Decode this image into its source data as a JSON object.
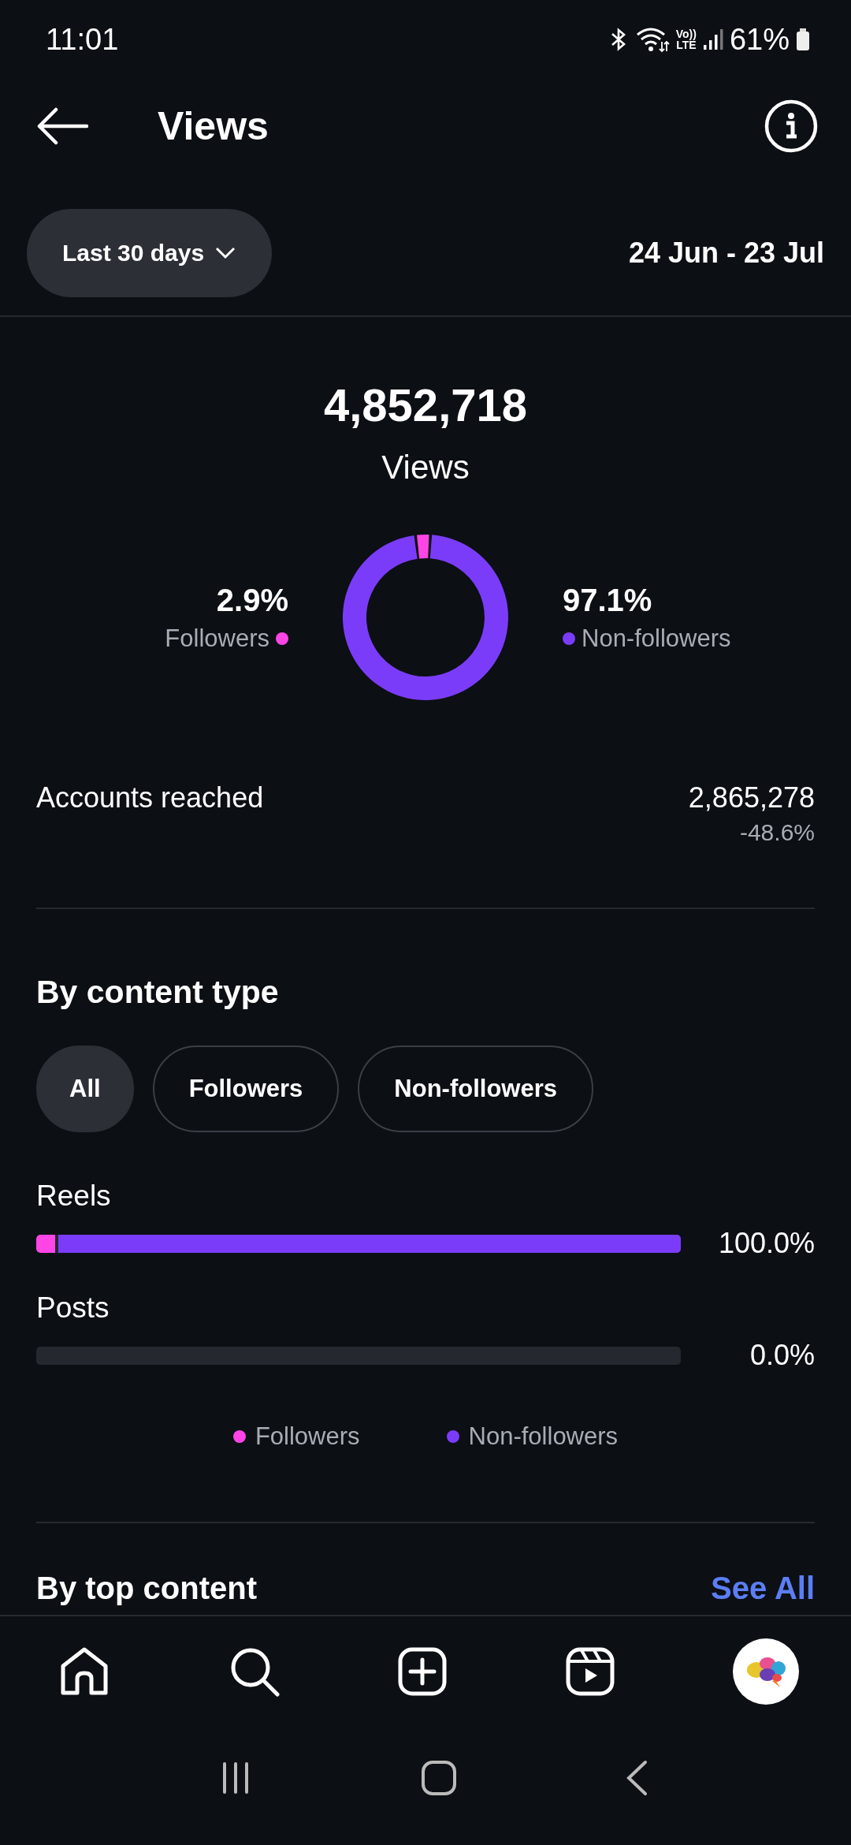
{
  "status_bar": {
    "time": "11:01",
    "network_label": [
      "Vo))",
      "LTE"
    ],
    "battery": "61%"
  },
  "header": {
    "title": "Views"
  },
  "filter": {
    "range": "Last 30 days",
    "dates": "24 Jun - 23 Jul"
  },
  "summary": {
    "total": "4,852,718",
    "label": "Views",
    "breakdown": [
      {
        "value": "2.9%",
        "label": "Followers",
        "color": "#ff45e6"
      },
      {
        "value": "97.1%",
        "label": "Non-followers",
        "color": "#7b3cf9"
      }
    ],
    "chart_data": {
      "type": "donut",
      "values": [
        2.9,
        97.1
      ]
    }
  },
  "accounts_reached": {
    "label": "Accounts reached",
    "value": "2,865,278",
    "change": "-48.6%"
  },
  "content_type": {
    "title": "By content type",
    "chips": [
      {
        "label": "All",
        "selected": true
      },
      {
        "label": "Followers",
        "selected": false
      },
      {
        "label": "Non-followers",
        "selected": false
      }
    ],
    "rows": [
      {
        "label": "Reels",
        "value": "100.0%",
        "segments": [
          {
            "color": "#ff45e6",
            "level": 0.029
          },
          {
            "color": "#7b3cf9",
            "level": 0.971
          }
        ]
      },
      {
        "label": "Posts",
        "value": "0.0%"
      }
    ],
    "legend": [
      {
        "label": "Followers",
        "color": "#ff45e6"
      },
      {
        "label": "Non-followers",
        "color": "#7b3cf9"
      }
    ]
  },
  "top_content": {
    "title": "By top content",
    "link": "See All"
  },
  "nav": [
    {
      "kind": "home"
    },
    {
      "kind": "search"
    },
    {
      "kind": "create"
    },
    {
      "kind": "reels"
    },
    {
      "kind": "profile"
    }
  ]
}
